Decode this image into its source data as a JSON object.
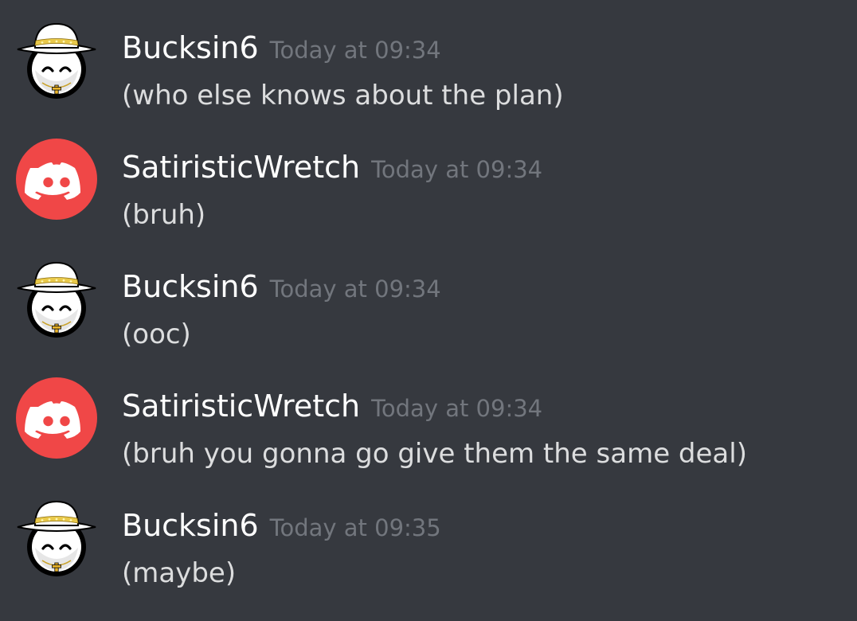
{
  "messages": [
    {
      "author": "Bucksin6",
      "timestamp": "Today at 09:34",
      "text": "(who else knows about the plan)",
      "avatar": "hat-character-avatar"
    },
    {
      "author": "SatiristicWretch",
      "timestamp": "Today at 09:34",
      "text": "(bruh)",
      "avatar": "discord-default-avatar"
    },
    {
      "author": "Bucksin6",
      "timestamp": "Today at 09:34",
      "text": "(ooc)",
      "avatar": "hat-character-avatar"
    },
    {
      "author": "SatiristicWretch",
      "timestamp": "Today at 09:34",
      "text": "(bruh you gonna go give them the same deal)",
      "avatar": "discord-default-avatar"
    },
    {
      "author": "Bucksin6",
      "timestamp": "Today at 09:35",
      "text": "(maybe)",
      "avatar": "hat-character-avatar"
    }
  ],
  "colors": {
    "background": "#36393f",
    "username": "#ffffff",
    "timestamp": "#72767d",
    "message_text": "#dcddde",
    "discord_avatar_bg": "#f04747"
  }
}
